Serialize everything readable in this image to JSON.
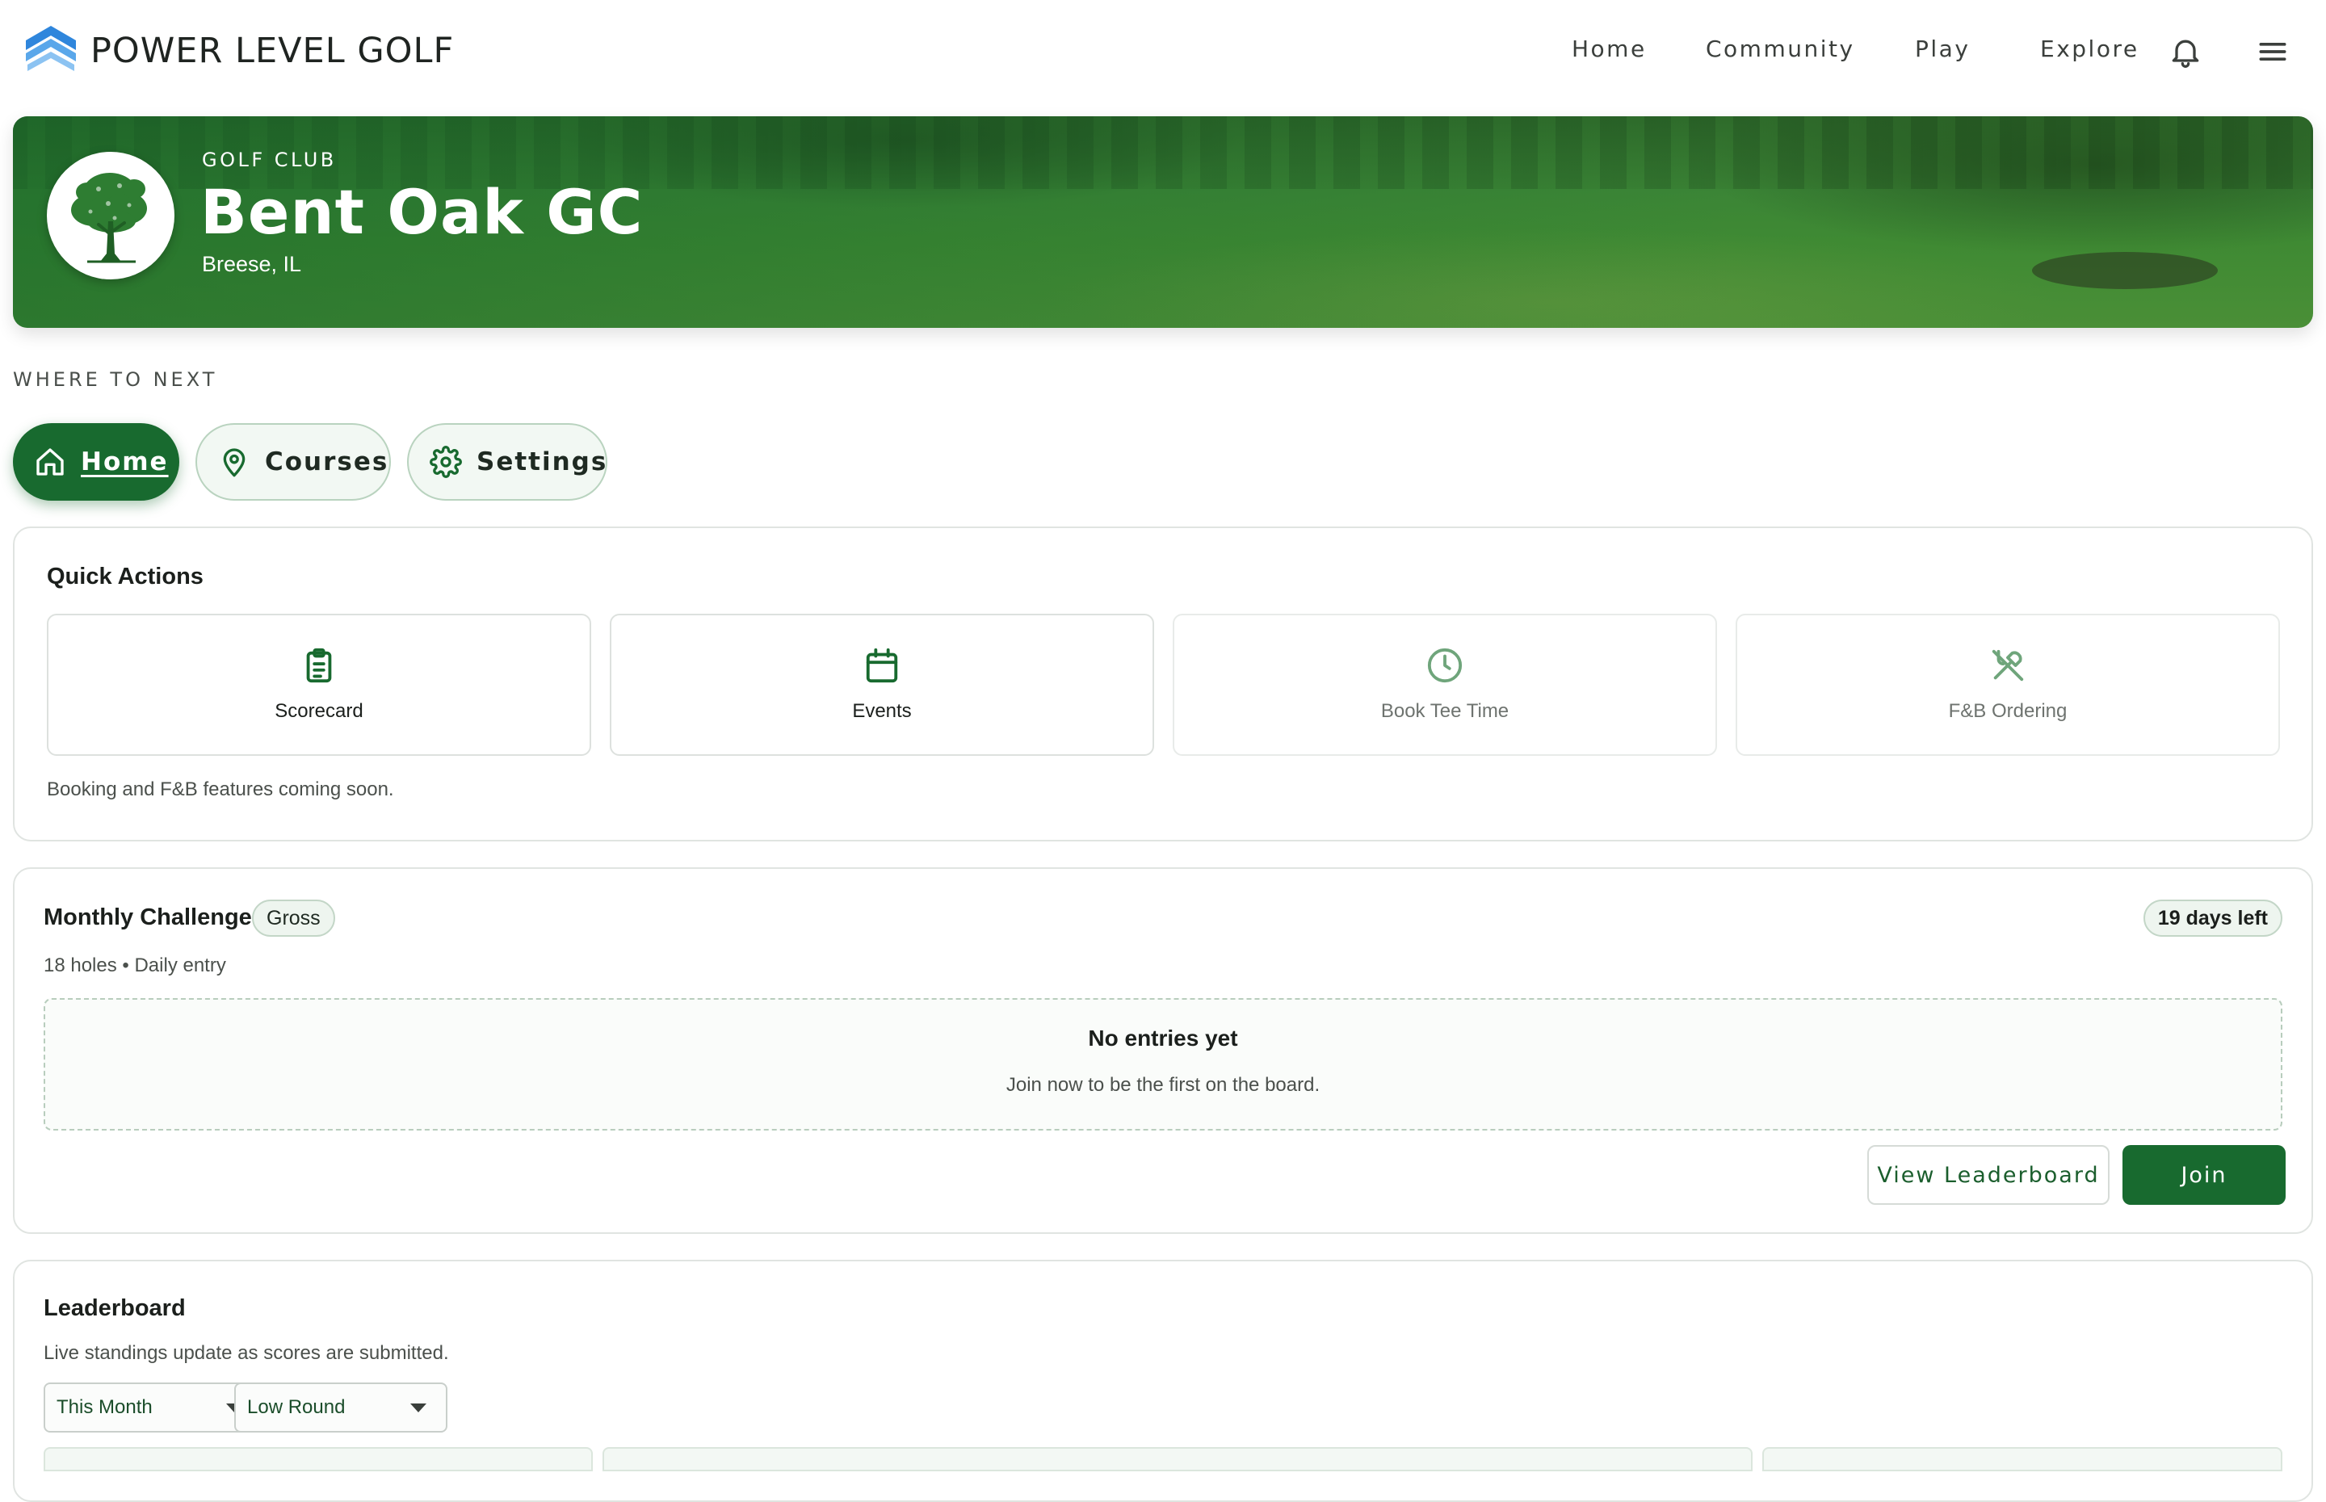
{
  "brand": {
    "name": "POWER LEVEL GOLF",
    "logo_icon": "chevron-stack-logo"
  },
  "nav": {
    "links": [
      "Home",
      "Community",
      "Play",
      "Explore"
    ],
    "bell_icon": "bell-icon",
    "menu_icon": "hamburger-menu-icon"
  },
  "club": {
    "kicker": "GOLF CLUB",
    "name": "Bent Oak GC",
    "location": "Breese, IL",
    "logo_icon": "oak-tree-icon"
  },
  "where_next": {
    "heading": "WHERE TO NEXT",
    "tabs": [
      {
        "label": "Home",
        "icon": "home-icon",
        "active": true
      },
      {
        "label": "Courses",
        "icon": "map-pin-icon",
        "active": false
      },
      {
        "label": "Settings",
        "icon": "gear-icon",
        "active": false
      }
    ]
  },
  "quick_actions": {
    "title": "Quick Actions",
    "tiles": [
      {
        "label": "Scorecard",
        "icon": "clipboard-icon",
        "enabled": true
      },
      {
        "label": "Events",
        "icon": "calendar-icon",
        "enabled": true
      },
      {
        "label": "Book Tee Time",
        "icon": "clock-icon",
        "enabled": false
      },
      {
        "label": "F&B Ordering",
        "icon": "utensils-icon",
        "enabled": false
      }
    ],
    "note": "Booking and F&B features coming soon."
  },
  "monthly_challenge": {
    "title": "Monthly Challenge",
    "badge": "Gross",
    "days_left": "19 days left",
    "meta": "18 holes • Daily entry",
    "empty_title": "No entries yet",
    "empty_sub": "Join now to be the first on the board.",
    "view_button": "View Leaderboard",
    "join_button": "Join"
  },
  "leaderboard": {
    "title": "Leaderboard",
    "subtitle": "Live standings update as scores are submitted.",
    "period_select": "This Month",
    "metric_select": "Low Round"
  },
  "colors": {
    "primary": "#186a2f",
    "hero_green": "#3b8536",
    "border": "#e0e4e1",
    "brand_blue": "#3b8fe0"
  }
}
